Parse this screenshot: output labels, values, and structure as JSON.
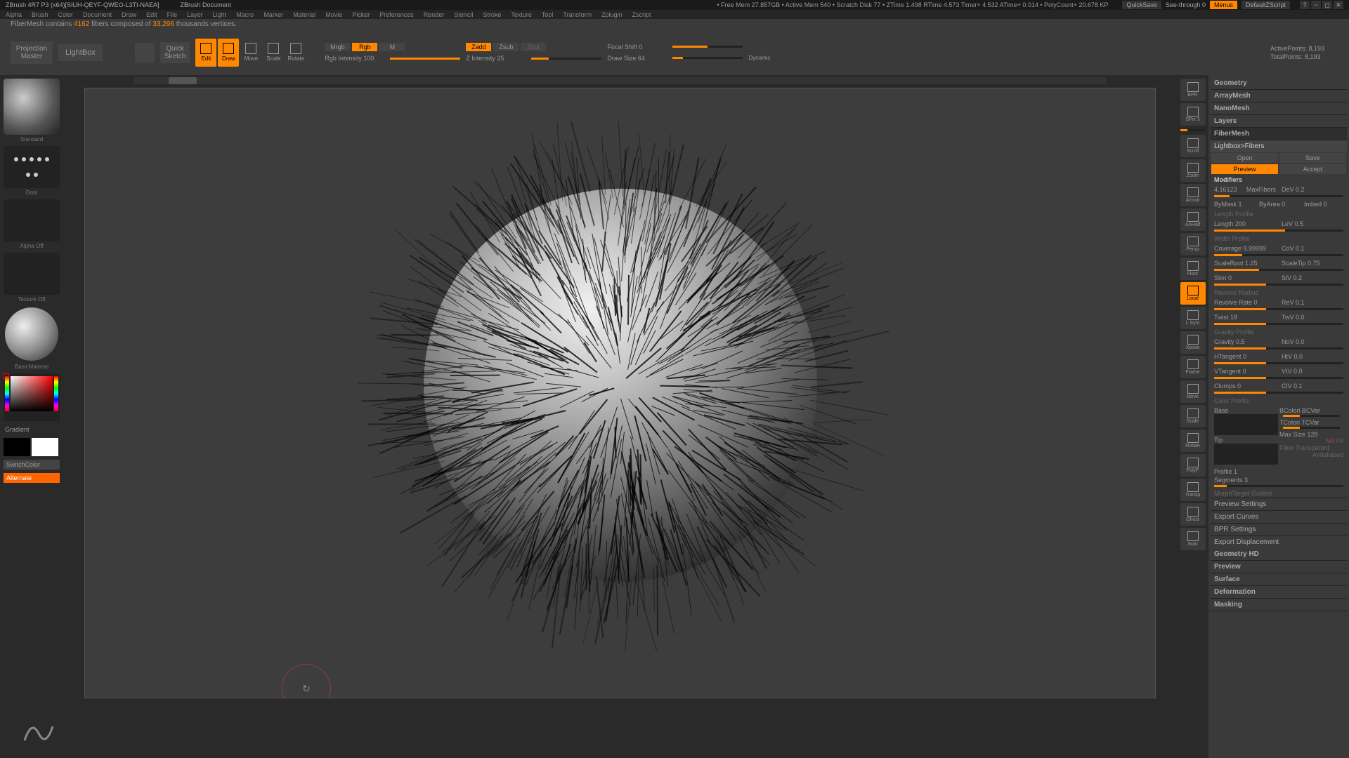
{
  "title": {
    "app": "ZBrush 4R7 P3 (x64)[SIUH-QEYF-QWEO-L3TI-NAEA]",
    "doc": "ZBrush Document",
    "stats": "• Free Mem 27.857GB • Active Mem 540 • Scratch Disk 77 • ZTime 1.498 RTime 4.573 Timer+ 4.532 ATime+ 0.014 • PolyCount+ 20.678 KP",
    "quicksave": "QuickSave",
    "see_through": "See-through  0",
    "menus": "Menus",
    "script": "DefaultZScript"
  },
  "menus": [
    "Alpha",
    "Brush",
    "Color",
    "Document",
    "Draw",
    "Edit",
    "File",
    "Layer",
    "Light",
    "Macro",
    "Marker",
    "Material",
    "Movie",
    "Picker",
    "Preferences",
    "Render",
    "Stencil",
    "Stroke",
    "Texture",
    "Tool",
    "Transform",
    "Zplugin",
    "Zscript"
  ],
  "status": {
    "prefix": "FiberMesh contains ",
    "fibers": "4162",
    "mid": " fibers composed of ",
    "verts": "33,296",
    "suffix": " thousands vertices."
  },
  "shelf": {
    "projection": "Projection\nMaster",
    "lightbox": "LightBox",
    "quicksketch": "Quick\nSketch",
    "tools": [
      {
        "label": "Edit",
        "active": true
      },
      {
        "label": "Draw",
        "active": true
      },
      {
        "label": "Move",
        "active": false
      },
      {
        "label": "Scale",
        "active": false
      },
      {
        "label": "Rotate",
        "active": false
      }
    ],
    "mrgb": "Mrgb",
    "rgb": "Rgb",
    "m": "M",
    "zadd": "Zadd",
    "zsub": "Zsub",
    "zcut": "Zcut",
    "rgb_intensity": "Rgb Intensity 100",
    "z_intensity": "Z Intensity 25",
    "focal_shift": "Focal Shift 0",
    "draw_size": "Draw Size 64",
    "dynamic": "Dynamic",
    "active_points": "ActivePoints: 8,193",
    "total_points": "TotalPoints: 8,193"
  },
  "left": {
    "brush": "Standard",
    "stroke": "Dots",
    "alpha": "Alpha Off",
    "texture": "Texture Off",
    "material": "BasicMaterial",
    "gradient": "Gradient",
    "switch": "SwitchColor",
    "alternate": "Alternate"
  },
  "right_icons": [
    "BPR",
    "SPix 3",
    "Scroll",
    "Zoom",
    "Actual",
    "AAHalf",
    "Persp",
    "Floor",
    "Local",
    "L.Sym",
    "Xpose",
    "Frame",
    "Move",
    "Scale",
    "Rotate",
    "PolyF",
    "Transp",
    "Ghost",
    "Solo"
  ],
  "panel": {
    "sections_top": [
      "Geometry",
      "ArrayMesh",
      "NanoMesh",
      "Layers"
    ],
    "fibermesh": "FiberMesh",
    "lightbox_fibers": "Lightbox>Fibers",
    "open": "Open",
    "save": "Save",
    "preview": "Preview",
    "accept": "Accept",
    "modifiers": "Modifiers",
    "maxfibers": {
      "val": "4.16123",
      "lbl": "MaxFibers"
    },
    "dev": "DeV 0.2",
    "bymask": "ByMask 1",
    "byarea": "ByArea 0.",
    "imbed": "Imbed 0",
    "length_profile": "Length Profile",
    "length": "Length 200",
    "lev": "LeV 0.5",
    "width_profile": "Width Profile",
    "coverage": "Coverage 9.99999",
    "cov": "CoV 0.1",
    "scaleroot": "ScaleRoot 1.25",
    "scaletip": "ScaleTip 0.75",
    "slim": "Slim 0",
    "slv": "SlV 0.2",
    "revolve_radius": "Revolve Radius",
    "revolve_rate": "Revolve Rate 0",
    "rev": "ReV 0.1",
    "twist": "Twist 18",
    "twv": "TwV 0.0",
    "gravity_profile": "Gravity Profile",
    "gravity": "Gravity 0.5",
    "nov": "NoV 0.0",
    "htangent": "HTangent 0",
    "htv": "HtV 0.0",
    "vtangent": "VTangent 0",
    "vtv": "VtV 0.0",
    "clumps": "Clumps 0",
    "clv": "ClV 0.1",
    "color_profile": "Color Profile",
    "base": "Base",
    "tip": "Tip",
    "bcolor": "BColori BCVar",
    "tcolor": "TColori TCVar",
    "maxsize": "Max Size 128",
    "fiber": "Fiber",
    "transparent": "Transparent",
    "antialiased": "Antialiased",
    "profile1": "Profile 1",
    "segments": "Segments 3",
    "morph": "MorphTarget Guided",
    "preview_settings": "Preview Settings",
    "export_curves": "Export Curves",
    "bpr_settings": "BPR Settings",
    "export_disp": "Export Displacement",
    "sections_bottom": [
      "Geometry HD",
      "Preview",
      "Surface",
      "Deformation",
      "Masking"
    ]
  }
}
